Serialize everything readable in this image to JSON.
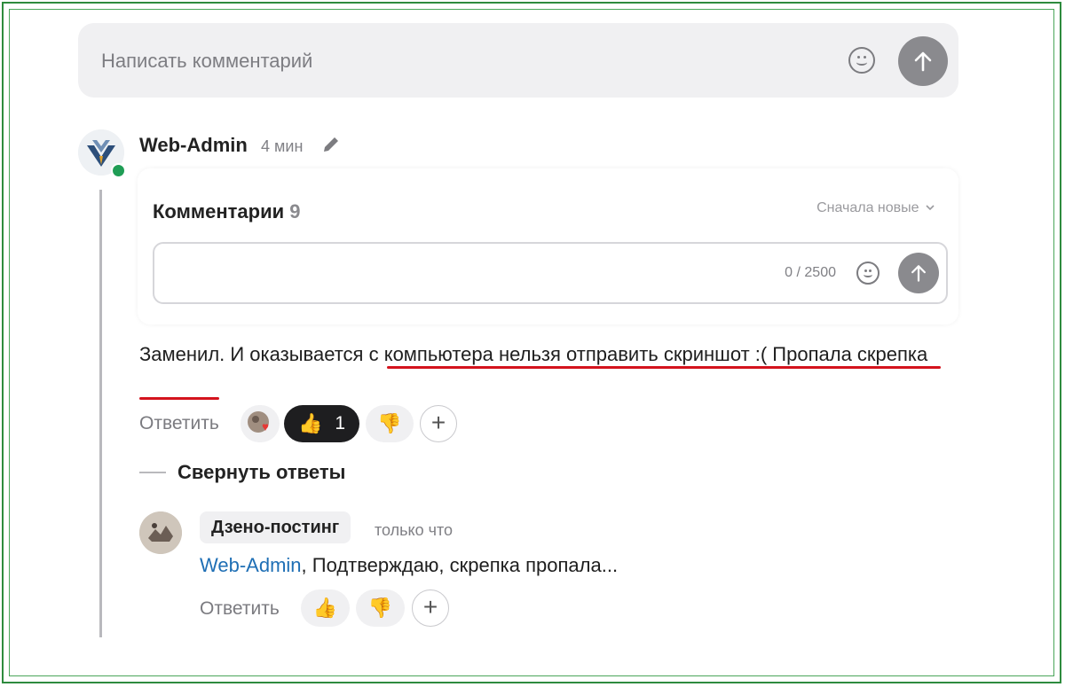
{
  "input": {
    "placeholder": "Написать комментарий",
    "emoji_icon": "smile-icon",
    "send_icon": "arrow-up-icon"
  },
  "comment": {
    "author": "Web-Admin",
    "time": "4 мин",
    "edit_icon": "pencil-icon",
    "embedded": {
      "title": "Комментарии",
      "count": "9",
      "sort": "Сначала новые",
      "char_counter": "0 / 2500"
    },
    "text_part1": "Заменил. И оказывается ",
    "text_part2": "с компьютера нельзя отправить скриншот :( Пропала скрепка",
    "reply_label": "Ответить",
    "like_count": "1",
    "collapse_label": "Свернуть ответы"
  },
  "reply": {
    "author": "Дзено-постинг",
    "time": "только что",
    "mention": "Web-Admin",
    "text": ", Подтверждаю, скрепка пропала...",
    "reply_label": "Ответить"
  },
  "colors": {
    "frame": "#2e8b3e",
    "underline": "#d4131d",
    "online": "#1f9d55",
    "mention": "#1f6fb5"
  }
}
